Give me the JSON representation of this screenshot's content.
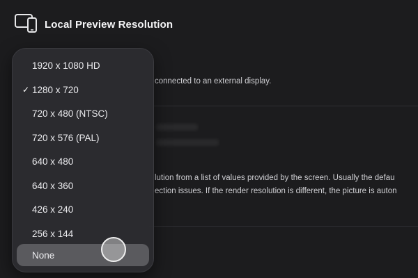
{
  "header": {
    "title": "Local Preview Resolution",
    "icon": "devices-icon"
  },
  "background": {
    "description_line": "connected to an external display.",
    "paragraph_line1": "lution from a list of values provided by the screen. Usually the defau",
    "paragraph_line2": "ection issues. If the render resolution is different, the picture is auton"
  },
  "menu": {
    "items": [
      {
        "label": "1920 x 1080 HD",
        "checked": false
      },
      {
        "label": "1280 x 720",
        "checked": true
      },
      {
        "label": "720 x 480 (NTSC)",
        "checked": false
      },
      {
        "label": "720 x 576 (PAL)",
        "checked": false
      },
      {
        "label": "640 x 480",
        "checked": false
      },
      {
        "label": "640 x 360",
        "checked": false
      },
      {
        "label": "426 x 240",
        "checked": false
      },
      {
        "label": "256 x 144",
        "checked": false
      },
      {
        "label": "None",
        "checked": false
      }
    ],
    "check_glyph": "✓",
    "highlighted_label": "None"
  },
  "colors": {
    "background": "#1c1c1e",
    "menu": "#2c2c30",
    "highlight": "#5a5a5e"
  }
}
